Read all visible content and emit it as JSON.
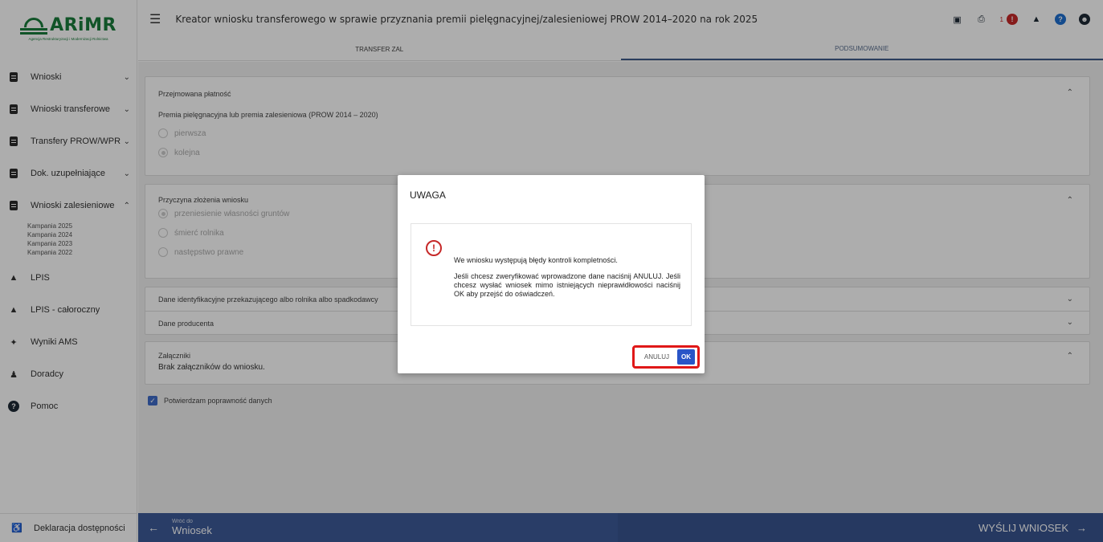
{
  "logo": {
    "name": "ARiMR",
    "subtitle": "Agencja Restrukturyzacji i Modernizacji Rolnictwa"
  },
  "header": {
    "title": "Kreator wniosku transferowego w sprawie przyznania premii pielęgnacyjnej/zalesieniowej PROW 2014–2020 na rok 2025",
    "notification_count": "1"
  },
  "tabs": [
    {
      "label": "TRANSFER ZAL"
    },
    {
      "label": "PODSUMOWANIE"
    }
  ],
  "sidebar": {
    "items": [
      {
        "label": "Wnioski"
      },
      {
        "label": "Wnioski transferowe"
      },
      {
        "label": "Transfery PROW/WPR"
      },
      {
        "label": "Dok. uzupełniające"
      },
      {
        "label": "Wnioski zalesieniowe"
      },
      {
        "label": "LPIS"
      },
      {
        "label": "LPIS - całoroczny"
      },
      {
        "label": "Wyniki AMS"
      },
      {
        "label": "Doradcy"
      },
      {
        "label": "Pomoc"
      }
    ],
    "campaigns": [
      "Kampania 2025",
      "Kampania 2024",
      "Kampania 2023",
      "Kampania 2022"
    ],
    "footer": "Deklaracja dostępności"
  },
  "main": {
    "payment": {
      "title": "Przejmowana płatność",
      "subtitle": "Premia pielęgnacyjna lub premia zalesieniowa (PROW 2014 – 2020)",
      "options": [
        "pierwsza",
        "kolejna"
      ]
    },
    "reason": {
      "title": "Przyczyna złożenia wniosku",
      "options": [
        "przeniesienie własności gruntów",
        "śmierć rolnika",
        "następstwo prawne"
      ]
    },
    "identification": {
      "title": "Dane identyfikacyjne przekazującego albo rolnika albo spadkodawcy"
    },
    "producer": {
      "title": "Dane producenta"
    },
    "attachments": {
      "title": "Załączniki",
      "text": "Brak załączników do wniosku."
    },
    "confirm_label": "Potwierdzam poprawność danych"
  },
  "bottom": {
    "back_small": "Wróć do",
    "back_big": "Wniosek",
    "send": "WYŚLIJ WNIOSEK"
  },
  "modal": {
    "title": "UWAGA",
    "message1": "We wniosku występują błędy kontroli kompletności.",
    "message2": "Jeśli chcesz zweryfikować wprowadzone dane naciśnij ANULUJ. Jeśli chcesz wysłać wniosek mimo istniejących nieprawidłowości naciśnij OK aby przejść do oświadczeń.",
    "cancel": "ANULUJ",
    "ok": "OK"
  }
}
